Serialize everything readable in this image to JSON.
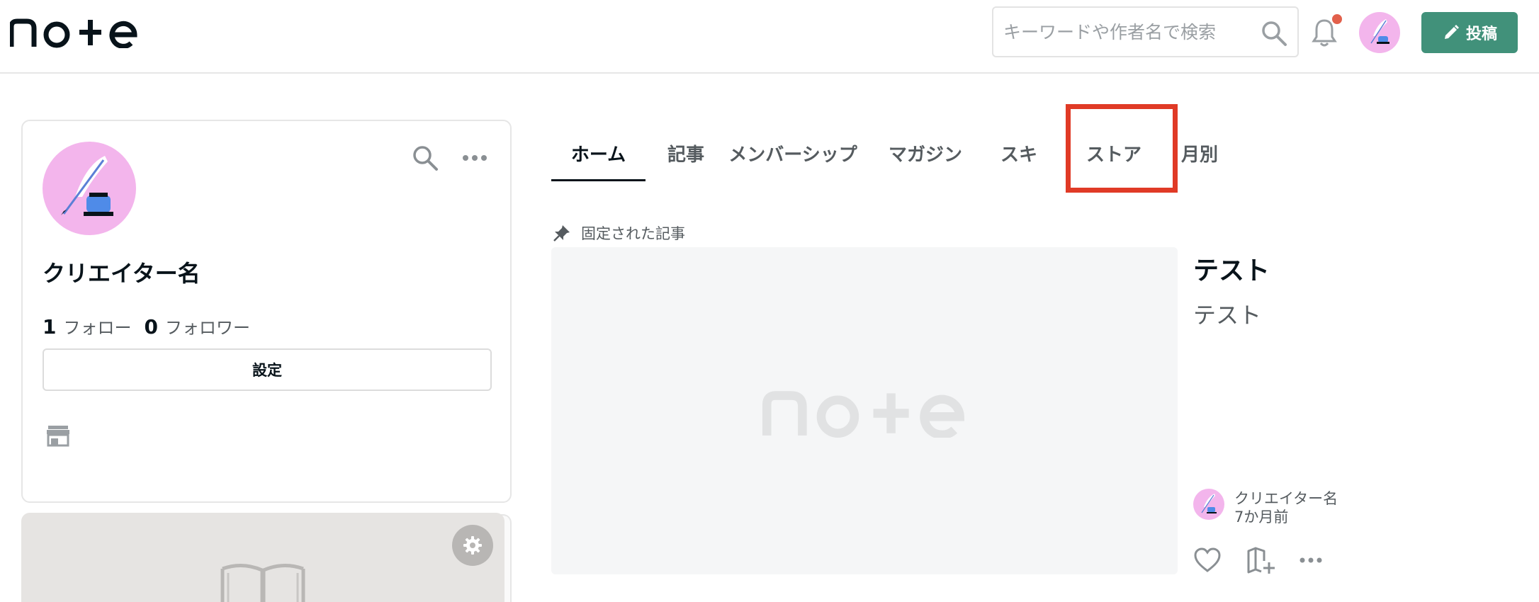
{
  "header": {
    "logo_text": "note",
    "search_placeholder": "キーワードや作者名で検索",
    "post_button_label": "投稿"
  },
  "profile": {
    "creator_name": "クリエイター名",
    "follow_count": "1",
    "follow_label": "フォロー",
    "follower_count": "0",
    "follower_label": "フォロワー",
    "settings_label": "設定"
  },
  "tabs": [
    {
      "label": "ホーム",
      "active": true
    },
    {
      "label": "記事",
      "active": false
    },
    {
      "label": "メンバーシップ",
      "active": false
    },
    {
      "label": "マガジン",
      "active": false
    },
    {
      "label": "スキ",
      "active": false
    },
    {
      "label": "ストア",
      "active": false
    },
    {
      "label": "月別",
      "active": false
    }
  ],
  "pinned": {
    "label": "固定された記事",
    "thumbnail_logo_text": "note",
    "title": "テスト",
    "body": "テスト",
    "author_name": "クリエイター名",
    "time_ago": "7か月前"
  },
  "colors": {
    "accent_green": "#41917a",
    "avatar_pink": "#f3b5ec",
    "notification_dot": "#e2604b",
    "highlight_red": "#e03a26"
  }
}
